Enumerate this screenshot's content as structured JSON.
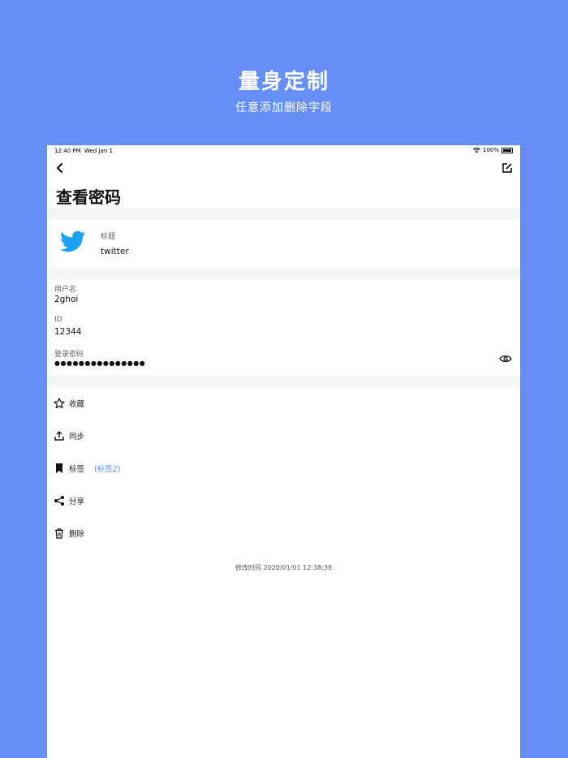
{
  "promo": {
    "headline": "量身定制",
    "subhead": "任意添加删除字段"
  },
  "status_bar": {
    "time": "12:40 PM",
    "date": "Wed Jan 1",
    "battery": "100%"
  },
  "page": {
    "title": "查看密码"
  },
  "entry": {
    "title_label": "标题",
    "title_value": "twitter",
    "icon": "twitter-bird-icon",
    "fields": [
      {
        "label": "用户名",
        "value": "2ghoi"
      },
      {
        "label": "ID",
        "value": "12344"
      },
      {
        "label": "登录密码",
        "value": "●●●●●●●●●●●●●●●"
      }
    ]
  },
  "actions": [
    {
      "label": "收藏",
      "icon": "star-icon"
    },
    {
      "label": "同步",
      "icon": "upload-icon"
    },
    {
      "label": "标签",
      "icon": "bookmark-icon",
      "value": "(标签2)"
    },
    {
      "label": "分享",
      "icon": "share-icon"
    },
    {
      "label": "删除",
      "icon": "trash-icon"
    }
  ],
  "footer": {
    "modified": "修改时间  2020/01/01 12:38:38"
  },
  "colors": {
    "background": "#658ff6",
    "accent": "#5a8ef0",
    "twitter": "#1da1f2"
  }
}
